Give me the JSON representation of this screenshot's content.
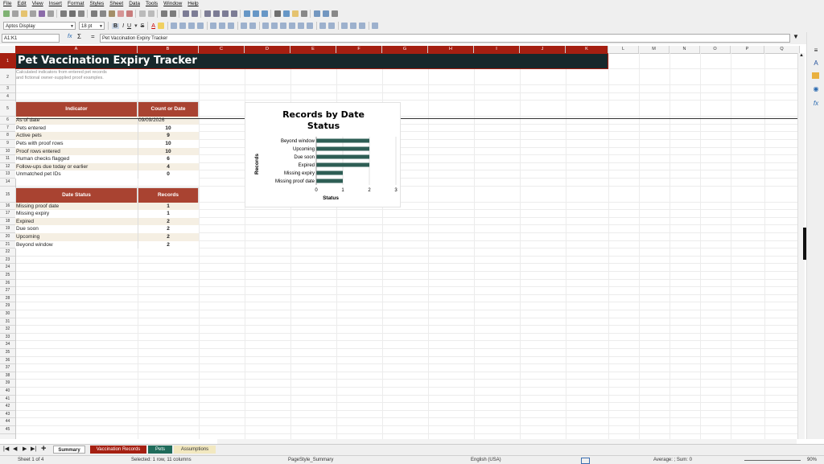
{
  "menu": [
    "File",
    "Edit",
    "View",
    "Insert",
    "Format",
    "Styles",
    "Sheet",
    "Data",
    "Tools",
    "Window",
    "Help"
  ],
  "toolbar": {
    "font_name": "Aptos Display",
    "font_size": "18 pt"
  },
  "formula_bar": {
    "name_box": "A1:K1",
    "formula": "Pet Vaccination Expiry Tracker",
    "fx": "fx",
    "sigma": "Σ",
    "equals": "="
  },
  "columns": [
    "A",
    "B",
    "C",
    "D",
    "E",
    "F",
    "G",
    "H",
    "I",
    "J",
    "K",
    "L",
    "M",
    "N",
    "O",
    "P",
    "Q"
  ],
  "rows": [
    "1",
    "2",
    "3",
    "4",
    "5",
    "6",
    "7",
    "8",
    "9",
    "10",
    "11",
    "12",
    "13",
    "14",
    "15",
    "16",
    "17",
    "18",
    "19",
    "20",
    "21",
    "22",
    "23",
    "24",
    "25",
    "26",
    "27",
    "28",
    "29",
    "30",
    "31",
    "32",
    "33",
    "34",
    "35",
    "36",
    "37",
    "38",
    "39",
    "40",
    "41",
    "42",
    "43",
    "44",
    "45"
  ],
  "sheet": {
    "title": "Pet Vaccination Expiry Tracker",
    "subtitle_line1": "Calculated indicators from entered pet records",
    "subtitle_line2": "and fictional owner-supplied proof examples.",
    "indicator_header": "Indicator",
    "count_header": "Count or Date",
    "indicators": [
      {
        "label": "As of date",
        "value": "09/09/2026"
      },
      {
        "label": "Pets entered",
        "value": "10"
      },
      {
        "label": "Active pets",
        "value": "9"
      },
      {
        "label": "Pets with proof rows",
        "value": "10"
      },
      {
        "label": "Proof rows entered",
        "value": "10"
      },
      {
        "label": "Human checks flagged",
        "value": "6"
      },
      {
        "label": "Follow-ups due today or earlier",
        "value": "4"
      },
      {
        "label": "Unmatched pet IDs",
        "value": "0"
      }
    ],
    "status_header": "Date Status",
    "records_header": "Records",
    "statuses": [
      {
        "label": "Missing proof date",
        "value": "1"
      },
      {
        "label": "Missing expiry",
        "value": "1"
      },
      {
        "label": "Expired",
        "value": "2"
      },
      {
        "label": "Due soon",
        "value": "2"
      },
      {
        "label": "Upcoming",
        "value": "2"
      },
      {
        "label": "Beyond window",
        "value": "2"
      }
    ]
  },
  "chart_data": {
    "type": "bar",
    "orientation": "horizontal",
    "title": "Records by Date Status",
    "title_line1": "Records by Date",
    "title_line2": "Status",
    "xlabel": "Status",
    "ylabel": "Records",
    "categories": [
      "Beyond window",
      "Upcoming",
      "Due soon",
      "Expired",
      "Missing expiry",
      "Missing proof date"
    ],
    "values": [
      2,
      2,
      2,
      2,
      1,
      1
    ],
    "xlim": [
      0,
      3
    ],
    "xticks": [
      "0",
      "1",
      "2",
      "3"
    ],
    "grid": true,
    "bar_color": "#2e5e55"
  },
  "tabs": [
    {
      "label": "Summary",
      "active": true
    },
    {
      "label": "Vaccination Records",
      "color": "#a51f11"
    },
    {
      "label": "Pets",
      "color": "#1f6b5a"
    },
    {
      "label": "Assumptions",
      "color": "#f2e8c0"
    }
  ],
  "status_bar": {
    "sheet": "Sheet 1 of 4",
    "selection": "Selected: 1 row, 11 columns",
    "page_style": "PageStyle_Summary",
    "language": "English (USA)",
    "aggregate": "Average: ; Sum: 0",
    "zoom": "90%"
  },
  "colors": {
    "accent": "#a51f11",
    "header_fill": "#a94331",
    "title_fill": "#17282b",
    "alt_row": "#f5efe3"
  }
}
